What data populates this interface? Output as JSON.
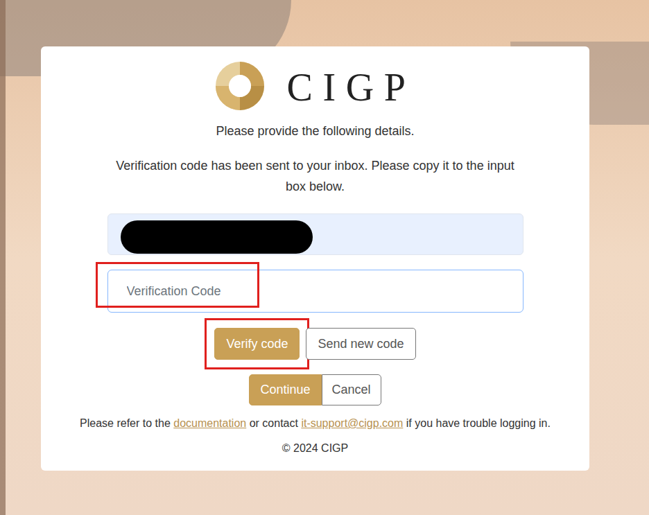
{
  "logo": {
    "text": "CIGP"
  },
  "intro": "Please provide the following details.",
  "message": "Verification code has been sent to your inbox. Please copy it to the input box below.",
  "email": {
    "redacted": true
  },
  "code": {
    "placeholder": "Verification Code",
    "highlighted": true
  },
  "buttons": [
    {
      "label": "Verify code",
      "kind": "primary",
      "highlighted": true
    },
    {
      "label": "Send new code",
      "kind": "secondary",
      "highlighted": false
    }
  ],
  "actions": [
    {
      "label": "Continue",
      "kind": "primary"
    },
    {
      "label": "Cancel",
      "kind": "secondary"
    }
  ],
  "help": {
    "before": "Please refer to the ",
    "link1": "documentation",
    "middle": " or contact ",
    "link2": "it-support@cigp.com",
    "after": " if you have trouble logging in."
  },
  "copyright": "© 2024 CIGP"
}
